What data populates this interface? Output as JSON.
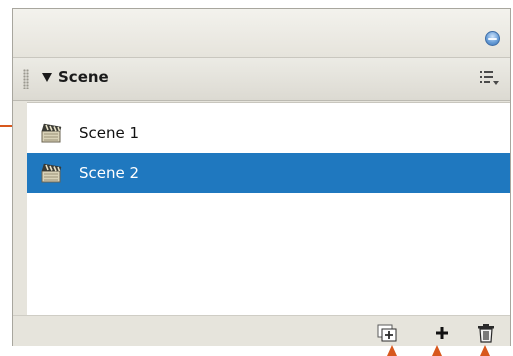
{
  "panel": {
    "title": "Scene"
  },
  "scenes": [
    {
      "label": "Scene 1",
      "selected": false,
      "icon": "clapperboard-icon"
    },
    {
      "label": "Scene 2",
      "selected": true,
      "icon": "clapperboard-icon"
    }
  ],
  "footer": {
    "buttons": [
      {
        "name": "duplicate-scene-button",
        "icon": "duplicate-scene-icon"
      },
      {
        "name": "add-scene-button",
        "icon": "plus-icon"
      },
      {
        "name": "delete-scene-button",
        "icon": "trash-icon"
      }
    ]
  },
  "colors": {
    "selection": "#1f78bf",
    "callout": "#d8581d",
    "panel_bg": "#e6e4dc"
  }
}
